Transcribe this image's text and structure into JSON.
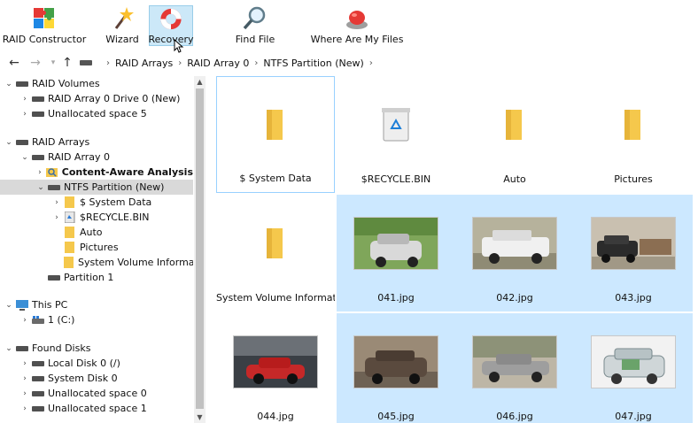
{
  "toolbar": {
    "raid_constructor": "RAID Constructor",
    "wizard": "Wizard",
    "recovery": "Recovery",
    "find_file": "Find File",
    "where_files": "Where Are My Files"
  },
  "breadcrumb": [
    "RAID Arrays",
    "RAID Array 0",
    "NTFS Partition (New)"
  ],
  "tree": {
    "raid_volumes": "RAID Volumes",
    "raid_array_drive": "RAID Array 0 Drive 0 (New)",
    "unallocated_5": "Unallocated space 5",
    "raid_arrays": "RAID Arrays",
    "raid_array_0": "RAID Array 0",
    "content_aware": "Content-Aware Analysis",
    "ntfs_partition": "NTFS Partition (New)",
    "system_data": "$ System Data",
    "recycle_bin": "$RECYCLE.BIN",
    "auto": "Auto",
    "pictures": "Pictures",
    "svi": "System Volume Information",
    "partition_1": "Partition 1",
    "this_pc": "This PC",
    "drive_c": "1 (C:)",
    "found_disks": "Found Disks",
    "local_disk": "Local Disk 0 (/)",
    "system_disk": "System Disk 0",
    "unallocated_0": "Unallocated space 0",
    "unallocated_1": "Unallocated space 1"
  },
  "files": [
    {
      "name": "$ System Data",
      "kind": "folder"
    },
    {
      "name": "$RECYCLE.BIN",
      "kind": "recycle"
    },
    {
      "name": "Auto",
      "kind": "folder"
    },
    {
      "name": "Pictures",
      "kind": "folder"
    },
    {
      "name": "System Volume Information",
      "kind": "folder"
    },
    {
      "name": "041.jpg",
      "kind": "photo"
    },
    {
      "name": "042.jpg",
      "kind": "photo"
    },
    {
      "name": "043.jpg",
      "kind": "photo"
    },
    {
      "name": "044.jpg",
      "kind": "photo"
    },
    {
      "name": "045.jpg",
      "kind": "photo"
    },
    {
      "name": "046.jpg",
      "kind": "photo"
    },
    {
      "name": "047.jpg",
      "kind": "photo"
    }
  ],
  "colors": {
    "selection": "#cce8ff",
    "folder": "#f5c84c",
    "tree_selected": "#d9d9d9"
  }
}
